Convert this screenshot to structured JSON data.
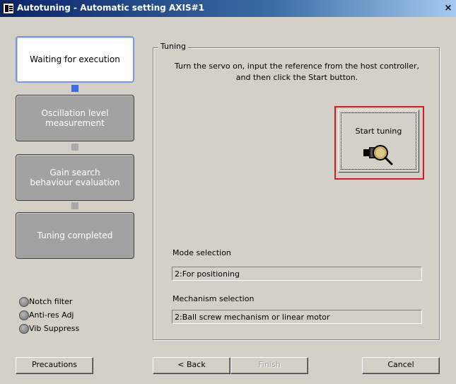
{
  "window": {
    "title": "Autotuning - Automatic setting AXIS#1",
    "close_label": "×"
  },
  "steps": [
    {
      "label": "Waiting for execution",
      "state": "active"
    },
    {
      "label": "Oscillation level measurement",
      "state": "inactive"
    },
    {
      "label": "Gain search behaviour evaluation",
      "state": "inactive"
    },
    {
      "label": "Tuning completed",
      "state": "inactive"
    }
  ],
  "indicators": [
    {
      "label": "Notch filter"
    },
    {
      "label": "Anti-res Adj"
    },
    {
      "label": "Vib Suppress"
    }
  ],
  "tuning": {
    "group_label": "Tuning",
    "instruction": "Turn the servo on, input the reference from the host controller, and then click the Start button.",
    "start_label": "Start tuning",
    "start_icon": "magnifier-motor-icon",
    "mode_label": "Mode selection",
    "mode_value": "2:For positioning",
    "mechanism_label": "Mechanism selection",
    "mechanism_value": "2:Ball screw mechanism or linear motor"
  },
  "buttons": {
    "precautions": "Precautions",
    "back": "< Back",
    "finish": "Finish",
    "cancel": "Cancel"
  },
  "colors": {
    "active_connector": "#3a6ee8",
    "highlight_outline": "#d01c24"
  }
}
